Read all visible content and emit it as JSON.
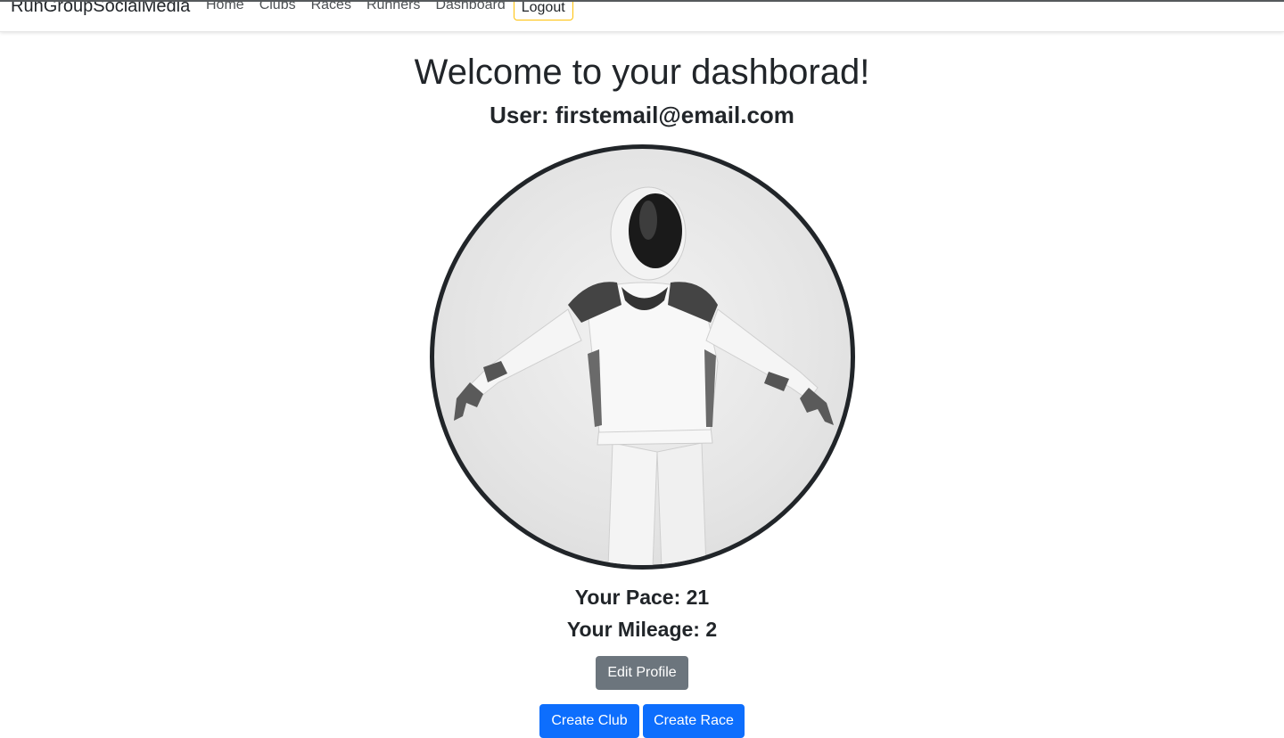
{
  "navbar": {
    "brand": "RunGroupSocialMedia",
    "links": [
      "Home",
      "Clubs",
      "Races",
      "Runners",
      "Dashboard"
    ],
    "logout_label": "Logout"
  },
  "dashboard": {
    "title": "Welcome to your dashborad!",
    "user_line": "User: firstemail@email.com",
    "pace_line": "Your Pace: 21",
    "mileage_line": "Your Mileage: 2"
  },
  "actions": {
    "edit_profile": "Edit Profile",
    "create_club": "Create Club",
    "create_race": "Create Race"
  },
  "colors": {
    "primary": "#0d6efd",
    "secondary": "#6c757d",
    "warning_outline": "#ffc107",
    "text": "#212529"
  },
  "icons": {
    "avatar": "astronaut-profile-image"
  }
}
